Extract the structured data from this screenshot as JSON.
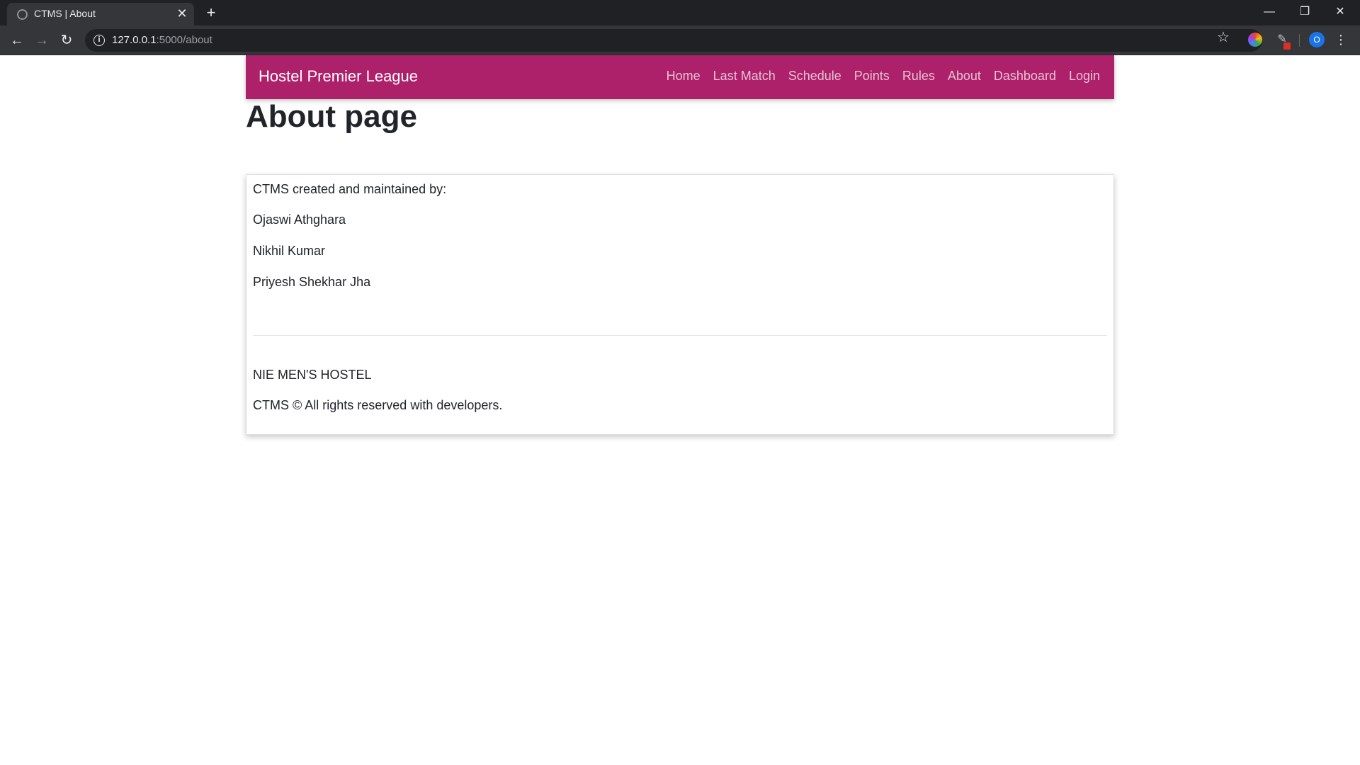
{
  "browser": {
    "tab_title": "CTMS | About",
    "url_host": "127.0.0.1",
    "url_path": ":5000/about",
    "profile_initial": "O"
  },
  "navbar": {
    "brand": "Hostel Premier League",
    "links": [
      {
        "label": "Home"
      },
      {
        "label": "Last Match"
      },
      {
        "label": "Schedule"
      },
      {
        "label": "Points"
      },
      {
        "label": "Rules"
      },
      {
        "label": "About"
      },
      {
        "label": "Dashboard"
      },
      {
        "label": "Login"
      }
    ],
    "color": "#ad216b"
  },
  "page": {
    "title": "About page"
  },
  "card": {
    "intro": "CTMS created and maintained by:",
    "developers": [
      "Ojaswi Athghara",
      "Nikhil Kumar",
      "Priyesh Shekhar Jha"
    ],
    "org": "NIE MEN'S HOSTEL",
    "copyright": "CTMS © All rights reserved with developers."
  }
}
